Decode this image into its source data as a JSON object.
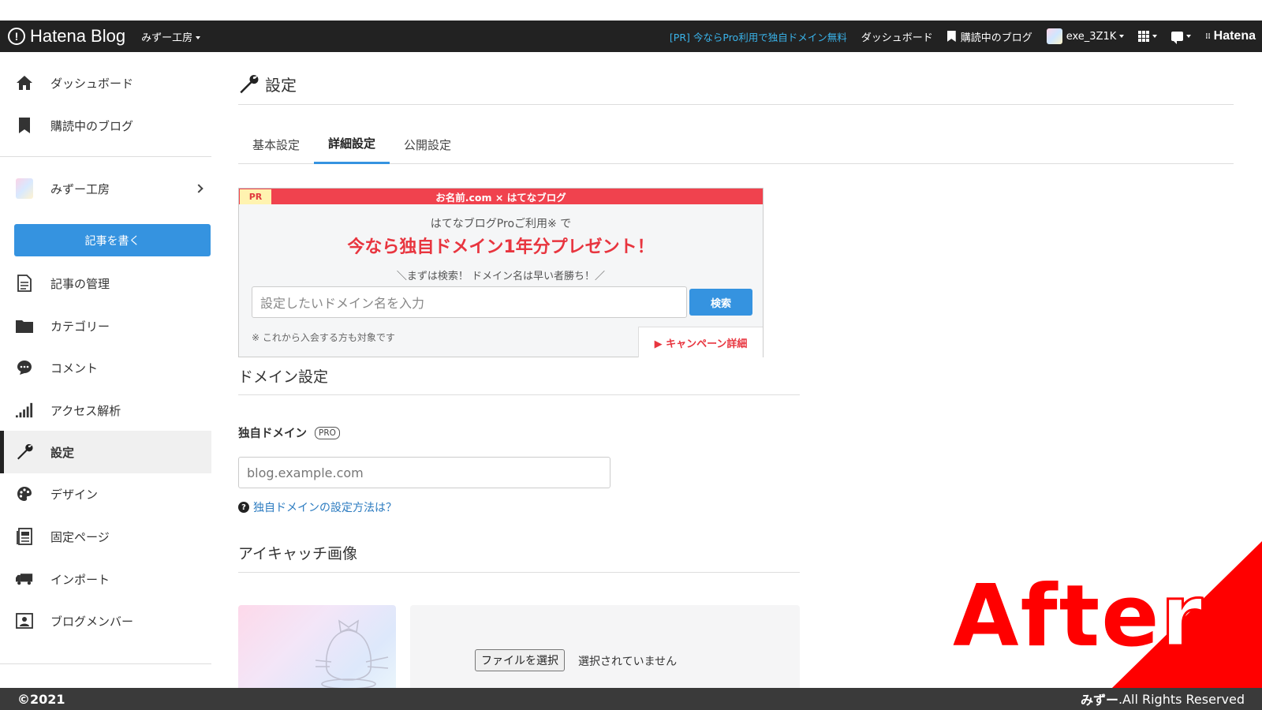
{
  "topbar": {
    "logo_text": "Hatena Blog",
    "blog_selector": "みずー工房",
    "pr_link": "[PR] 今ならPro利用で独自ドメイン無料",
    "dashboard": "ダッシュボード",
    "subscribed": "購読中のブログ",
    "username": "exe_3Z1K",
    "hatena_logo": "Hatena"
  },
  "sidebar": {
    "items": [
      {
        "label": "ダッシュボード",
        "icon": "home-icon"
      },
      {
        "label": "購読中のブログ",
        "icon": "bookmark-icon"
      }
    ],
    "blog_name": "みずー工房",
    "write_button": "記事を書く",
    "menu": [
      {
        "label": "記事の管理",
        "icon": "document-icon"
      },
      {
        "label": "カテゴリー",
        "icon": "folder-icon"
      },
      {
        "label": "コメント",
        "icon": "comment-icon"
      },
      {
        "label": "アクセス解析",
        "icon": "bar-chart-icon"
      },
      {
        "label": "設定",
        "icon": "wrench-icon",
        "active": true
      },
      {
        "label": "デザイン",
        "icon": "palette-icon"
      },
      {
        "label": "固定ページ",
        "icon": "page-icon"
      },
      {
        "label": "インポート",
        "icon": "truck-icon"
      },
      {
        "label": "ブログメンバー",
        "icon": "members-icon"
      }
    ]
  },
  "main": {
    "title": "設定",
    "tabs": [
      {
        "label": "基本設定",
        "active": false
      },
      {
        "label": "詳細設定",
        "active": true
      },
      {
        "label": "公開設定",
        "active": false
      }
    ],
    "pr": {
      "badge": "PR",
      "header": "お名前.com × はてなブログ",
      "sub": "はてなブログProご利用※ で",
      "headline": "今なら独自ドメイン1年分プレゼント！",
      "hint": "＼まずは検索！ ドメイン名は早い者勝ち！／",
      "input_placeholder": "設定したいドメイン名を入力",
      "search_button": "検索",
      "note": "※ これから入会する方も対象です",
      "campaign_link": "▶ キャンペーン詳細"
    },
    "domain_section": {
      "title": "ドメイン設定",
      "field_label": "独自ドメイン",
      "pro_badge": "PRO",
      "input_placeholder": "blog.example.com",
      "help_link": "独自ドメインの設定方法は？"
    },
    "eyecatch_section": {
      "title": "アイキャッチ画像",
      "file_button": "ファイルを選択",
      "file_status": "選択されていません"
    }
  },
  "footer": {
    "copyright": "©2021",
    "owner": "みずー",
    "rights": ".All Rights Reserved"
  },
  "overlay": {
    "label_main": "Afte",
    "label_last": "r",
    "color": "#ff0000"
  }
}
